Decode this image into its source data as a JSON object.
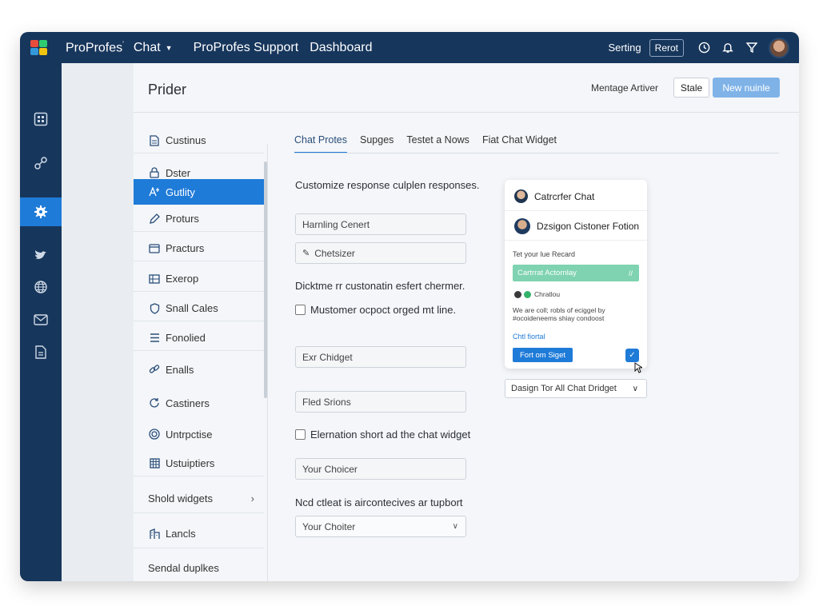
{
  "topbar": {
    "brand": "ProProfes",
    "brand_mark": "'",
    "product": "Chat",
    "nav": [
      "ProProfes Support",
      "Dashboard"
    ],
    "setting_label": "Serting",
    "reset_label": "Rerot"
  },
  "page": {
    "title": "Prider",
    "manage_link": "Mentage Artiver",
    "state_button": "Stale",
    "new_button": "New nuinle"
  },
  "menu": {
    "items": [
      {
        "label": "Custinus",
        "icon": "document-icon"
      },
      {
        "label": "Dster",
        "icon": "lock-icon"
      },
      {
        "label": "Gutlity",
        "icon": "text-icon"
      },
      {
        "label": "Proturs",
        "icon": "pencil-icon"
      },
      {
        "label": "Practurs",
        "icon": "card-icon"
      },
      {
        "label": "Exerop",
        "icon": "grid-icon"
      },
      {
        "label": "Snall Cales",
        "icon": "shield-icon"
      },
      {
        "label": "Fonolied",
        "icon": "lines-icon"
      },
      {
        "label": "Enalls",
        "icon": "link-icon"
      },
      {
        "label": "Castiners",
        "icon": "refresh-icon"
      },
      {
        "label": "Untrpctise",
        "icon": "target-icon"
      },
      {
        "label": "Ustuiptiers",
        "icon": "table-icon"
      },
      {
        "label": "Shold widgets",
        "icon": ""
      },
      {
        "label": "Lancls",
        "icon": "building-icon"
      },
      {
        "label": "Sendal duplkes",
        "icon": ""
      }
    ],
    "active_index": 2
  },
  "tabs": [
    "Chat Protes",
    "Supges",
    "Testet a Nows",
    "Fiat Chat Widget"
  ],
  "form": {
    "intro": "Customize response culplen responses.",
    "field1": "Harnling Cenert",
    "field2": "Chetsizer",
    "para1": "Dicktme rr custonatin esfert chermer.",
    "check1": "Mustomer ocpoct orged mt line.",
    "field3": "Exr Chidget",
    "field4": "Fled Srions",
    "check2": "Elernation short ad the chat widget",
    "field5": "Your Choicer",
    "para2": "Ncd ctleat is aircontecives ar tupbort",
    "select1": "Your Choiter"
  },
  "preview": {
    "header": "Catrcrfer Chat",
    "title": "Dzsigon Cistoner Fotion",
    "sub": "Tet your lue Recard",
    "green_bar": "Cartrrat Actornlay",
    "green_tick": "//",
    "status": "Chratlou",
    "body": "We are coll; robls of eciggel by #ocoideneems shiay condoost",
    "link": "Chtl fiortal",
    "button": "Fort om Siget",
    "checkbox_symbol": "✓"
  },
  "design_select": "Dasign Tor All Chat Dridget",
  "colors": {
    "topbar": "#17365c",
    "accent": "#1f7bd8",
    "success": "#7fd3b0"
  }
}
